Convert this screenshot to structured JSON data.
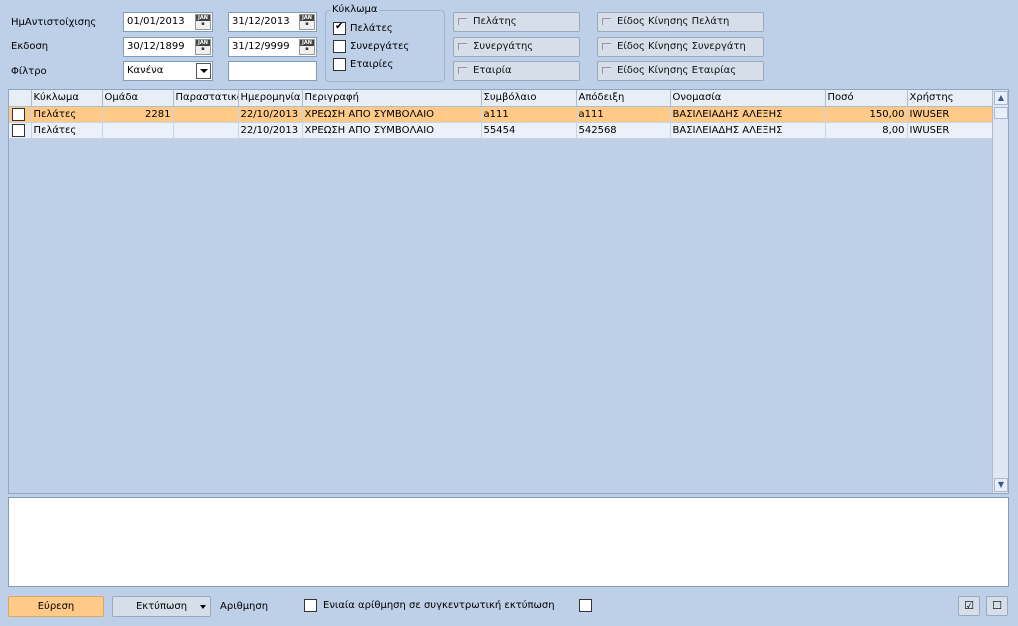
{
  "filters": {
    "date_label": "ΗμΑντιστοίχισης",
    "issue_label": "Εκδοση",
    "filter_label": "Φίλτρο",
    "date_from": "01/01/2013",
    "date_to": "31/12/2013",
    "issue_from": "30/12/1899",
    "issue_to": "31/12/9999",
    "filter_value": "Κανένα",
    "filter_text": "",
    "calendar_icon_text": "JAN"
  },
  "circuit": {
    "title": "Κύκλωμα",
    "options": [
      {
        "label": "Πελάτες",
        "checked": true
      },
      {
        "label": "Συνεργάτες",
        "checked": false
      },
      {
        "label": "Εταιρίες",
        "checked": false
      }
    ]
  },
  "entity_buttons": [
    "Πελάτης",
    "Συνεργάτης",
    "Εταιρία"
  ],
  "movement_buttons": [
    "Είδος Κίνησης Πελάτη",
    "Είδος Κίνησης Συνεργάτη",
    "Είδος Κίνησης Εταιρίας"
  ],
  "grid": {
    "columns": [
      "Κύκλωμα",
      "Ομάδα",
      "Παραστατικό",
      "Ημερομηνία",
      "Περιγραφή",
      "Συμβόλαιο",
      "Απόδειξη",
      "Ονομασία",
      "Ποσό",
      "Χρήστης"
    ],
    "rows": [
      {
        "selected": true,
        "circuit": "Πελάτες",
        "group": "2281",
        "document": "",
        "date": "22/10/2013",
        "description": "ΧΡΕΩΣΗ ΑΠΟ ΣΥΜΒΟΛΑΙΟ",
        "contract": "a111",
        "receipt": "a111",
        "name": "ΒΑΣΙΛΕΙΑΔΗΣ ΑΛΕΞΗΣ",
        "amount": "150,00",
        "user": "IWUSER"
      },
      {
        "selected": false,
        "circuit": "Πελάτες",
        "group": "",
        "document": "",
        "date": "22/10/2013",
        "description": "ΧΡΕΩΣΗ ΑΠΟ ΣΥΜΒΟΛΑΙΟ",
        "contract": "55454",
        "receipt": "542568",
        "name": "ΒΑΣΙΛΕΙΑΔΗΣ ΑΛΕΞΗΣ",
        "amount": "8,00",
        "user": "IWUSER"
      }
    ]
  },
  "footer": {
    "find_label": "Εύρεση",
    "print_label": "Εκτύπωση",
    "numbering_label": "Αριθμηση",
    "unified_numbering_label": "Ενιαία αρίθμηση σε συγκεντρωτική εκτύπωση",
    "check_all_glyph": "☑",
    "uncheck_all_glyph": "☐"
  },
  "colors": {
    "background": "#bdd0e8",
    "selected_row": "#ffc987",
    "find_button": "#ffc987"
  }
}
